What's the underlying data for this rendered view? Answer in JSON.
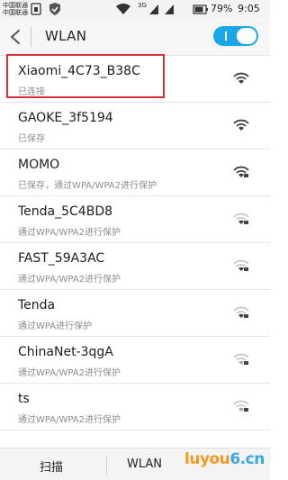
{
  "status_bar": {
    "carrier1": "中国联通",
    "carrier2": "中国联通",
    "net_type": "3G",
    "battery": "79%",
    "time": "9:05"
  },
  "header": {
    "title": "WLAN",
    "toggle_on": true
  },
  "networks": [
    {
      "ssid": "Xiaomi_4C73_B38C",
      "status": "已连接",
      "locked": false
    },
    {
      "ssid": "GAOKE_3f5194",
      "status": "已保存",
      "locked": false
    },
    {
      "ssid": "MOMO",
      "status": "已保存，通过WPA/WPA2进行保护",
      "locked": true
    },
    {
      "ssid": "Tenda_5C4BD8",
      "status": "通过WPA/WPA2进行保护",
      "locked": true
    },
    {
      "ssid": "FAST_59A3AC",
      "status": "通过WPA/WPA2进行保护",
      "locked": true
    },
    {
      "ssid": "Tenda",
      "status": "通过WPA进行保护",
      "locked": true
    },
    {
      "ssid": "ChinaNet-3qgA",
      "status": "通过WPA/WPA2进行保护",
      "locked": true
    },
    {
      "ssid": "ts",
      "status": "通过WPA/WPA2进行保护",
      "locked": true
    }
  ],
  "bottom_bar": {
    "scan_label": "扫描",
    "wlan_label": "WLAN"
  },
  "watermark": {
    "part1": "lu",
    "part2": "you",
    "part3": "6",
    "part4": ".cn"
  },
  "colors": {
    "accent": "#1aa7e8",
    "highlight": "#d9303a"
  }
}
